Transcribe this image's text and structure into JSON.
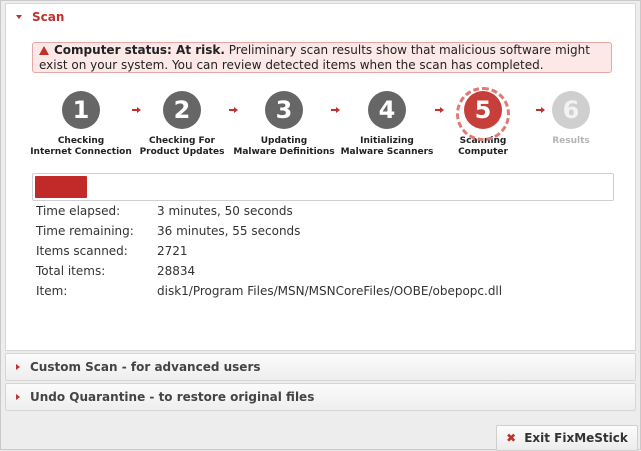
{
  "scan": {
    "title": "Scan",
    "alert": {
      "bold": "Computer status: At risk.",
      "text": " Preliminary scan results show that malicious software might exist on your system. You can review detected items when the scan has completed."
    },
    "steps": [
      {
        "num": "1",
        "line1": "Checking",
        "line2": "Internet Connection",
        "state": "done"
      },
      {
        "num": "2",
        "line1": "Checking For",
        "line2": "Product Updates",
        "state": "done"
      },
      {
        "num": "3",
        "line1": "Updating",
        "line2": "Malware Definitions",
        "state": "done"
      },
      {
        "num": "4",
        "line1": "Initializing",
        "line2": "Malware Scanners",
        "state": "done"
      },
      {
        "num": "5",
        "line1": "Scanning",
        "line2": "Computer",
        "state": "active"
      },
      {
        "num": "6",
        "line1": "Results",
        "line2": "",
        "state": "pending"
      }
    ],
    "progress_fraction": 0.09,
    "stats": [
      {
        "label": "Time elapsed:",
        "value": "3 minutes, 50 seconds"
      },
      {
        "label": "Time remaining:",
        "value": "36 minutes, 55 seconds"
      },
      {
        "label": "Items scanned:",
        "value": "2721"
      },
      {
        "label": "Total items:",
        "value": "28834"
      },
      {
        "label": "Item:",
        "value": "disk1/Program Files/MSN/MSNCoreFiles/OOBE/obepopc.dll"
      }
    ]
  },
  "custom_scan": {
    "title": "Custom Scan - for advanced users"
  },
  "undo_quarantine": {
    "title": "Undo Quarantine - to restore original files"
  },
  "exit_button": {
    "label": "Exit FixMeStick"
  },
  "colors": {
    "accent": "#c0302c",
    "progress": "#c12a28",
    "alert_bg": "#fde8e8"
  }
}
